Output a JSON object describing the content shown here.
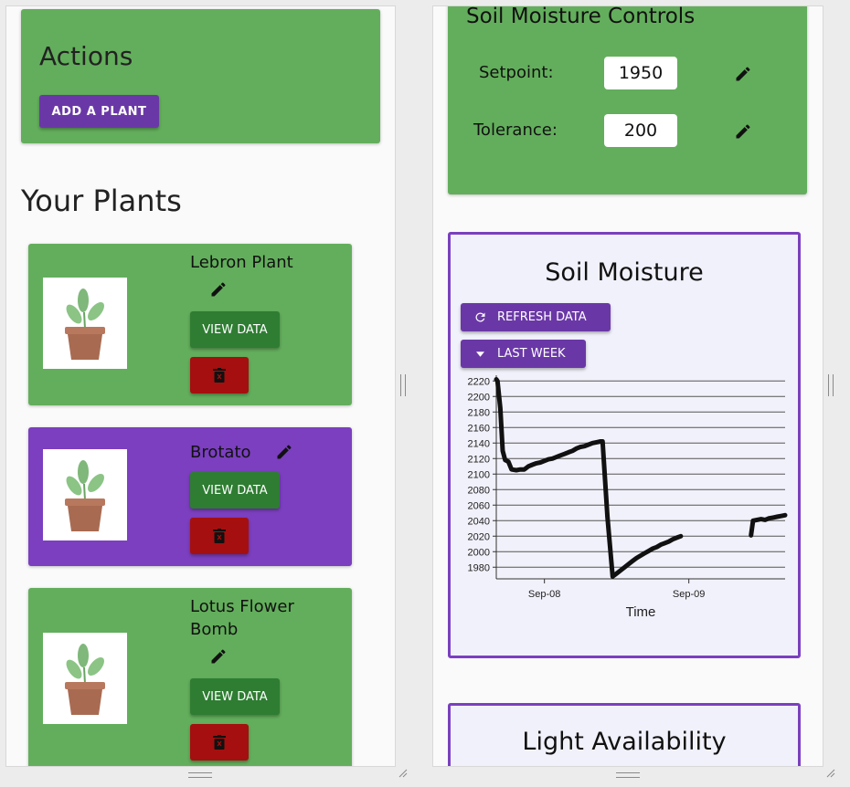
{
  "left_pane": {
    "actions": {
      "title": "Actions",
      "add_plant_label": "Add a Plant"
    },
    "section_title": "Your Plants",
    "view_data_label": "View Data",
    "plants": [
      {
        "name": "Lebron Plant",
        "card_color": "green"
      },
      {
        "name": "Brotato",
        "card_color": "purple"
      },
      {
        "name": "Lotus Flower Bomb",
        "card_color": "green"
      }
    ]
  },
  "right_pane": {
    "soil_controls": {
      "title": "Soil Moisture Controls",
      "setpoint_label": "Setpoint:",
      "setpoint_value": "1950",
      "tolerance_label": "Tolerance:",
      "tolerance_value": "200"
    },
    "soil_chart": {
      "title": "Soil Moisture",
      "refresh_label": "Refresh Data",
      "range_label": "Last Week"
    },
    "light_chart": {
      "title": "Light Availability"
    }
  },
  "colors": {
    "card_green": "#63ae5c",
    "card_purple": "#7b3fbf",
    "button_purple": "#6a38a6",
    "button_green": "#2e7d32",
    "button_red": "#a50f0f"
  },
  "icons": [
    "pencil-icon",
    "trash-icon",
    "refresh-icon",
    "caret-down-icon",
    "plant-pot-icon"
  ],
  "chart_data": {
    "type": "line",
    "title": "Soil Moisture",
    "xlabel": "Time",
    "ylabel": "",
    "x_tick_labels": [
      "Sep-08",
      "Sep-09"
    ],
    "yticks": [
      1980,
      2000,
      2020,
      2040,
      2060,
      2080,
      2100,
      2120,
      2140,
      2160,
      2180,
      2200,
      2220
    ],
    "ylim": [
      1965,
      2225
    ],
    "xlim_hours": [
      0,
      72
    ],
    "grid": true,
    "series": [
      {
        "segments": [
          [
            [
              0,
              2222
            ],
            [
              0.3,
              2220
            ],
            [
              1,
              2185
            ],
            [
              1.6,
              2130
            ],
            [
              2.2,
              2118
            ],
            [
              3,
              2116
            ],
            [
              3.8,
              2106
            ],
            [
              5,
              2105
            ],
            [
              6,
              2106
            ],
            [
              7,
              2106
            ],
            [
              8,
              2110
            ],
            [
              9,
              2112
            ],
            [
              10,
              2114
            ],
            [
              11,
              2115
            ],
            [
              12,
              2117
            ],
            [
              13,
              2119
            ],
            [
              14,
              2120
            ],
            [
              15,
              2122
            ],
            [
              16,
              2124
            ],
            [
              17,
              2126
            ],
            [
              18,
              2128
            ],
            [
              19,
              2130
            ],
            [
              20,
              2133
            ],
            [
              21,
              2135
            ],
            [
              22,
              2136
            ],
            [
              23,
              2138
            ],
            [
              24,
              2140
            ],
            [
              25,
              2141
            ],
            [
              26,
              2142
            ],
            [
              26.5,
              2142
            ],
            [
              27.7,
              2045
            ],
            [
              29,
              1968
            ],
            [
              30,
              1972
            ],
            [
              31,
              1976
            ],
            [
              32,
              1980
            ],
            [
              33,
              1984
            ],
            [
              34,
              1988
            ],
            [
              35,
              1992
            ],
            [
              36,
              1995
            ],
            [
              37,
              1998
            ],
            [
              38,
              2001
            ],
            [
              39,
              2004
            ],
            [
              40,
              2006
            ],
            [
              41,
              2009
            ],
            [
              42,
              2011
            ],
            [
              43,
              2013
            ],
            [
              44,
              2016
            ],
            [
              45,
              2018
            ],
            [
              46,
              2020
            ]
          ],
          [
            [
              63.5,
              2021
            ],
            [
              64,
              2040
            ],
            [
              65,
              2041
            ],
            [
              66,
              2042
            ],
            [
              67,
              2041
            ],
            [
              68,
              2043
            ],
            [
              69,
              2044
            ],
            [
              70,
              2045
            ],
            [
              71,
              2046
            ],
            [
              72,
              2047
            ]
          ]
        ]
      }
    ]
  }
}
